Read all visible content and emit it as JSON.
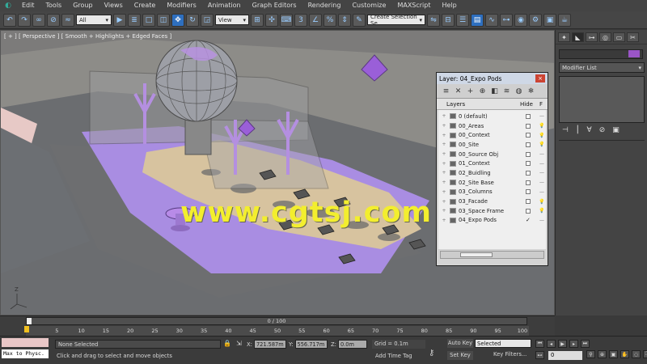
{
  "menu": {
    "items": [
      "Edit",
      "Tools",
      "Group",
      "Views",
      "Create",
      "Modifiers",
      "Animation",
      "Graph Editors",
      "Rendering",
      "Customize",
      "MAXScript",
      "Help"
    ]
  },
  "toolbar": {
    "selection_filter": "All",
    "reference_coord": "View",
    "named_selection": "Create Selection Se",
    "snap_label": "3",
    "percent_snap_label": "%"
  },
  "viewport": {
    "label": "[ + ] [ Perspective ] [ Smooth + Highlights + Edged Faces ]",
    "watermark": "www.cgtsj.com",
    "axis_label": "Z"
  },
  "layer_dialog": {
    "title": "Layer: 04_Expo Pods",
    "close_glyph": "×",
    "col_layers": "Layers",
    "col_hide": "Hide",
    "col_freeze": "F",
    "layers": [
      {
        "name": "0 (default)"
      },
      {
        "name": "00_Areas"
      },
      {
        "name": "00_Context"
      },
      {
        "name": "00_Site"
      },
      {
        "name": "00_Source Obj"
      },
      {
        "name": "01_Context"
      },
      {
        "name": "02_Buidling"
      },
      {
        "name": "02_Site Base"
      },
      {
        "name": "03_Columns"
      },
      {
        "name": "03_Facade"
      },
      {
        "name": "03_Space Frame"
      },
      {
        "name": "04_Expo Pods"
      }
    ]
  },
  "command_panel": {
    "modifier_list": "Modifier List",
    "object_color": "#9a55c7"
  },
  "timeline": {
    "slider_label": "0 / 100",
    "progress": 0,
    "ticks": [
      {
        "v": 5
      },
      {
        "v": 10
      },
      {
        "v": 15
      },
      {
        "v": 20
      },
      {
        "v": 25
      },
      {
        "v": 30
      },
      {
        "v": 35
      },
      {
        "v": 40
      },
      {
        "v": 45
      },
      {
        "v": 50
      },
      {
        "v": 55
      },
      {
        "v": 60
      },
      {
        "v": 65
      },
      {
        "v": 70
      },
      {
        "v": 75
      },
      {
        "v": 80
      },
      {
        "v": 85
      },
      {
        "v": 90
      },
      {
        "v": 95
      },
      {
        "v": 100
      }
    ]
  },
  "status": {
    "listener": "Max to Physc.",
    "selection": "None Selected",
    "prompt": "Click and drag to select and move objects",
    "x_label": "X:",
    "x_value": "721.587m",
    "y_label": "Y:",
    "y_value": "556.717m",
    "z_label": "Z:",
    "z_value": "0.0m",
    "grid": "Grid = 0.1m",
    "add_time_tag": "Add Time Tag",
    "auto_key": "Auto Key",
    "set_key": "Set Key",
    "key_mode": "Selected",
    "key_filters": "Key Filters...",
    "frame": "0"
  }
}
